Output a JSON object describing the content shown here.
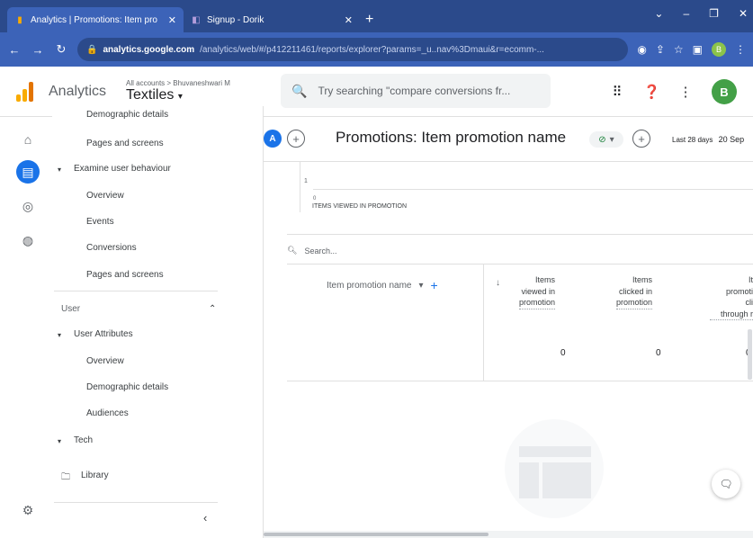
{
  "browser": {
    "tabs": [
      {
        "title": "Analytics | Promotions: Item pro",
        "icon": "analytics-icon",
        "active": true
      },
      {
        "title": "Signup - Dorik",
        "icon": "dorik-icon",
        "active": false
      }
    ],
    "new_tab": "+",
    "url_host": "analytics.google.com",
    "url_path": "/analytics/web/#/p412211461/reports/explorer?params=_u..nav%3Dmaui&r=ecomm-...",
    "profile_letter": "B"
  },
  "ga": {
    "app_name": "Analytics",
    "account_crumb": "All accounts > Bhuvaneshwari M",
    "property": "Textiles",
    "search_placeholder": "Try searching \"compare conversions fr...",
    "avatar_letter": "B"
  },
  "nav": {
    "items": [
      {
        "label": "Demographic details",
        "level": 2
      },
      {
        "label": "Pages and screens",
        "level": 2
      },
      {
        "label": "Examine user behaviour",
        "level": 1
      },
      {
        "label": "Overview",
        "level": 2
      },
      {
        "label": "Events",
        "level": 2
      },
      {
        "label": "Conversions",
        "level": 2
      },
      {
        "label": "Pages and screens",
        "level": 2
      }
    ],
    "user_section": "User",
    "user_items": [
      {
        "label": "User Attributes",
        "level": 1
      },
      {
        "label": "Overview",
        "level": 2
      },
      {
        "label": "Demographic details",
        "level": 2
      },
      {
        "label": "Audiences",
        "level": 2
      },
      {
        "label": "Tech",
        "level": 1
      }
    ],
    "library": "Library"
  },
  "report": {
    "compare_letter": "A",
    "title": "Promotions: Item promotion name",
    "date_label": "Last 28 days",
    "date_value": "20 Sep",
    "chart_ytick": "1",
    "chart_xtick": "0",
    "chart_legend": "ITEMS VIEWED IN PROMOTION",
    "search_placeholder": "Search...",
    "dimension_header": "Item promotion name",
    "metrics": [
      {
        "line1": "Items",
        "line2": "viewed in",
        "line3": "promotion",
        "value": "0"
      },
      {
        "line1": "Items",
        "line2": "clicked in",
        "line3": "promotion",
        "value": "0"
      },
      {
        "line1": "It",
        "line2": "promoti",
        "line3": "cli",
        "line4": "through r",
        "value": "0"
      }
    ]
  }
}
